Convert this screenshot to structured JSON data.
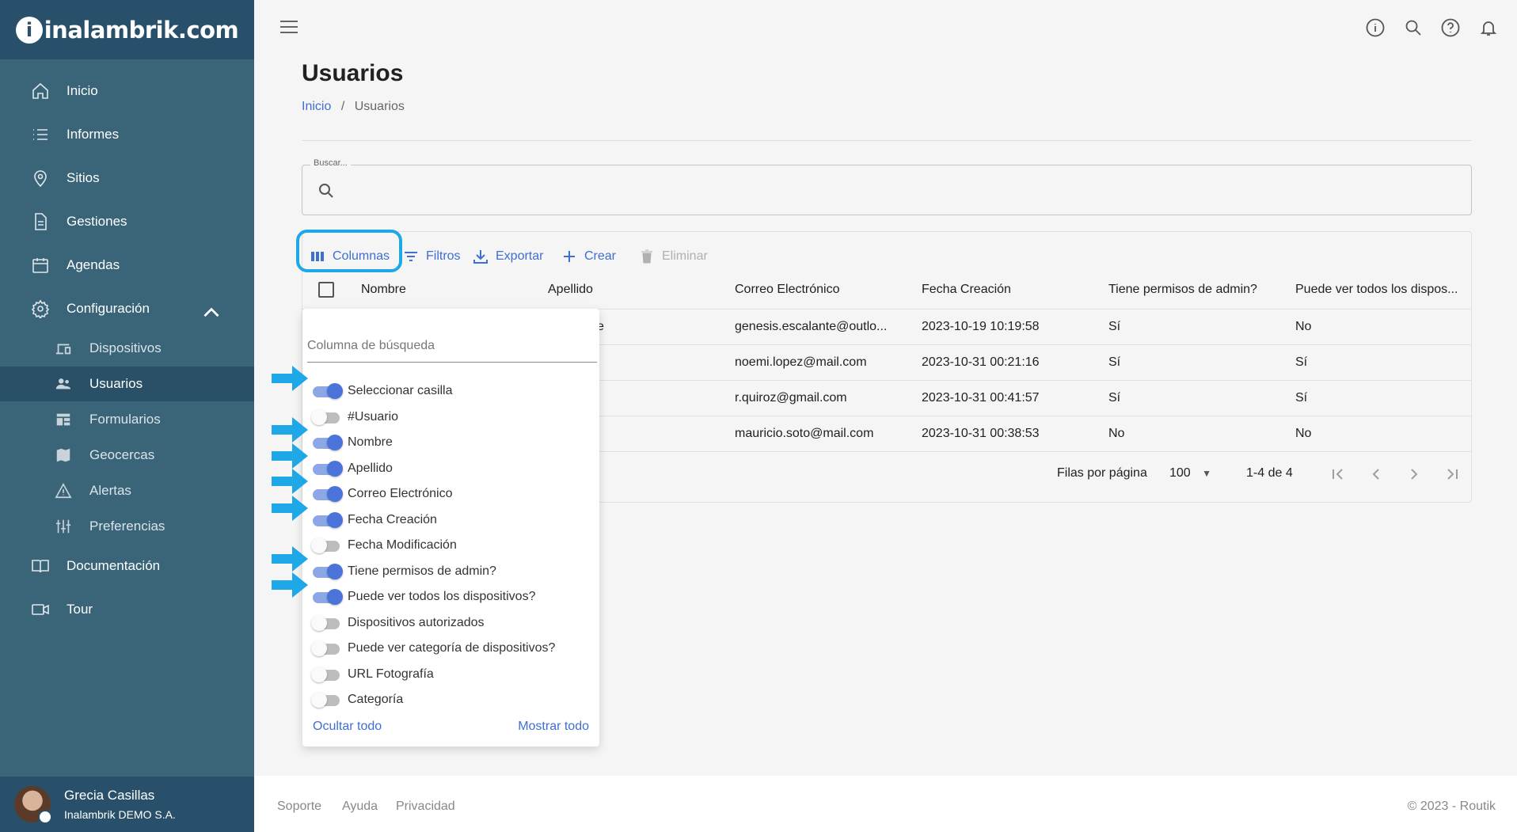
{
  "brand": {
    "logo_text": "inalambrik.com"
  },
  "sidebar": {
    "items": [
      {
        "label": "Inicio",
        "icon": "home-icon"
      },
      {
        "label": "Informes",
        "icon": "list-icon"
      },
      {
        "label": "Sitios",
        "icon": "location-icon"
      },
      {
        "label": "Gestiones",
        "icon": "document-icon"
      },
      {
        "label": "Agendas",
        "icon": "calendar-icon"
      },
      {
        "label": "Configuración",
        "icon": "gear-icon"
      },
      {
        "label": "Documentación",
        "icon": "book-icon"
      },
      {
        "label": "Tour",
        "icon": "video-icon"
      }
    ],
    "subitems": [
      {
        "label": "Dispositivos",
        "icon": "devices-icon"
      },
      {
        "label": "Usuarios",
        "icon": "users-icon"
      },
      {
        "label": "Formularios",
        "icon": "forms-icon"
      },
      {
        "label": "Geocercas",
        "icon": "map-icon"
      },
      {
        "label": "Alertas",
        "icon": "warning-icon"
      },
      {
        "label": "Preferencias",
        "icon": "sliders-icon"
      }
    ],
    "user": {
      "name": "Grecia Casillas",
      "company": "Inalambrik DEMO S.A."
    }
  },
  "page": {
    "title": "Usuarios",
    "breadcrumb": {
      "home": "Inicio",
      "sep": "/",
      "current": "Usuarios"
    },
    "search": {
      "label": "Buscar..."
    }
  },
  "toolbar": {
    "columns": "Columnas",
    "filters": "Filtros",
    "export": "Exportar",
    "create": "Crear",
    "delete": "Eliminar"
  },
  "table": {
    "headers": [
      "Nombre",
      "Apellido",
      "Correo Electrónico",
      "Fecha Creación",
      "Tiene permisos de admin?",
      "Puede ver todos los dispos..."
    ],
    "rows": [
      {
        "apellido_tail": "e",
        "email": "genesis.escalante@outlo...",
        "fecha": "2023-10-19 10:19:58",
        "admin": "Sí",
        "todos": "No"
      },
      {
        "apellido_tail": "",
        "email": "noemi.lopez@mail.com",
        "fecha": "2023-10-31 00:21:16",
        "admin": "Sí",
        "todos": "Sí"
      },
      {
        "apellido_tail": "",
        "email": "r.quiroz@gmail.com",
        "fecha": "2023-10-31 00:41:57",
        "admin": "Sí",
        "todos": "Sí"
      },
      {
        "apellido_tail": "",
        "email": "mauricio.soto@mail.com",
        "fecha": "2023-10-31 00:38:53",
        "admin": "No",
        "todos": "No"
      }
    ],
    "pagination": {
      "rows_label": "Filas por página",
      "rows_value": "100",
      "range": "1-4 de 4"
    }
  },
  "columns_panel": {
    "search_placeholder": "Columna de búsqueda",
    "toggles": [
      {
        "label": "Seleccionar casilla",
        "on": true
      },
      {
        "label": "#Usuario",
        "on": false
      },
      {
        "label": "Nombre",
        "on": true
      },
      {
        "label": "Apellido",
        "on": true
      },
      {
        "label": "Correo Electrónico",
        "on": true
      },
      {
        "label": "Fecha Creación",
        "on": true
      },
      {
        "label": "Fecha Modificación",
        "on": false
      },
      {
        "label": "Tiene permisos de admin?",
        "on": true
      },
      {
        "label": "Puede ver todos los dispositivos?",
        "on": true
      },
      {
        "label": "Dispositivos autorizados",
        "on": false
      },
      {
        "label": "Puede ver categoría de dispositivos?",
        "on": false
      },
      {
        "label": "URL Fotografía",
        "on": false
      },
      {
        "label": "Categoría",
        "on": false
      }
    ],
    "hide_all": "Ocultar todo",
    "show_all": "Mostrar todo"
  },
  "footer": {
    "links": [
      "Soporte",
      "Ayuda",
      "Privacidad"
    ],
    "copyright": "© 2023 - Routik"
  },
  "colors": {
    "sidebar": "#3a6478",
    "sidebar_dark": "#29506a",
    "accent": "#3f6fd1",
    "highlight": "#1ea8e8"
  }
}
